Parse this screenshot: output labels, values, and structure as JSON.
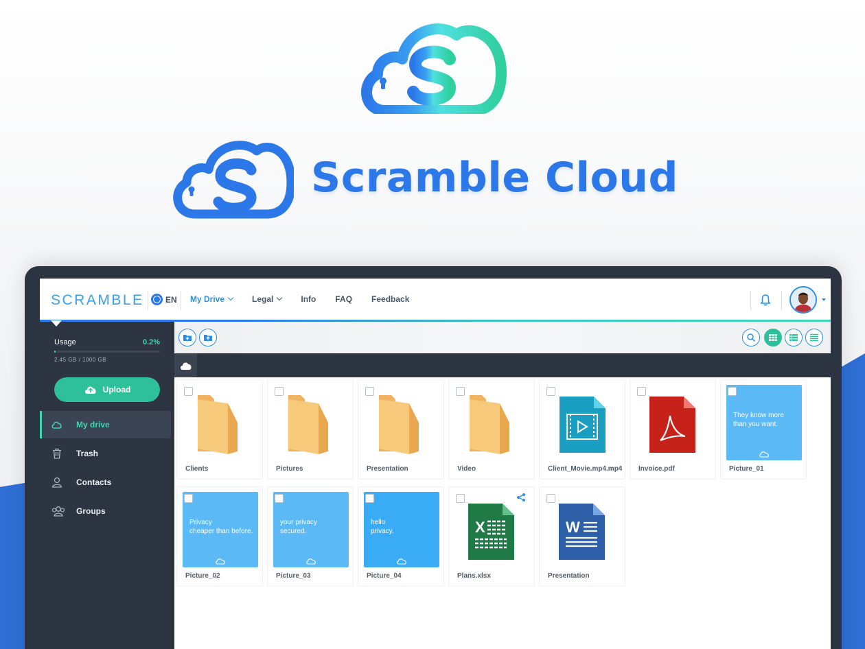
{
  "brand": {
    "name": "Scramble Cloud"
  },
  "app": {
    "logo_text": "SCRAMBLE",
    "language": "EN",
    "nav": [
      {
        "label": "My Drive",
        "has_dropdown": true,
        "active": true
      },
      {
        "label": "Legal",
        "has_dropdown": true,
        "active": false
      },
      {
        "label": "Info",
        "has_dropdown": false,
        "active": false
      },
      {
        "label": "FAQ",
        "has_dropdown": false,
        "active": false
      },
      {
        "label": "Feedback",
        "has_dropdown": false,
        "active": false
      }
    ]
  },
  "sidebar": {
    "usage_label": "Usage",
    "usage_percent": "0.2%",
    "usage_fraction": 0.002,
    "usage_detail": "2.45 GB / 1000 GB",
    "upload_label": "Upload",
    "items": [
      {
        "label": "My drive",
        "icon": "cloud-icon",
        "active": true
      },
      {
        "label": "Trash",
        "icon": "trash-icon",
        "active": false
      },
      {
        "label": "Contacts",
        "icon": "user-icon",
        "active": false
      },
      {
        "label": "Groups",
        "icon": "group-icon",
        "active": false
      }
    ]
  },
  "toolbar": {
    "left_buttons": [
      "new-folder-icon",
      "upload-folder-icon"
    ],
    "right_buttons": [
      "search-icon",
      "grid-view-icon",
      "list-view-icon",
      "compact-list-icon"
    ],
    "active_view": "grid-view-icon"
  },
  "files": [
    {
      "name": "Clients",
      "type": "folder"
    },
    {
      "name": "Pictures",
      "type": "folder"
    },
    {
      "name": "Presentation",
      "type": "folder"
    },
    {
      "name": "Video",
      "type": "folder"
    },
    {
      "name": "Client_Movie.mp4.mp4",
      "type": "video"
    },
    {
      "name": "Invoice.pdf",
      "type": "pdf"
    },
    {
      "name": "Picture_01",
      "type": "image",
      "text": "They know more\nthan you want."
    },
    {
      "name": "Picture_02",
      "type": "image",
      "text": "Privacy\ncheaper than before."
    },
    {
      "name": "Picture_03",
      "type": "image",
      "text": "your privacy\nsecured."
    },
    {
      "name": "Picture_04",
      "type": "image",
      "text": "hello\nprivacy."
    },
    {
      "name": "Plans.xlsx",
      "type": "excel",
      "shared": true
    },
    {
      "name": "Presentation",
      "type": "word"
    }
  ],
  "colors": {
    "brand_blue": "#2c78e8",
    "accent_teal": "#3fd7b5",
    "sidebar_bg": "#2d3542",
    "upload_green": "#2ec09a",
    "picture_blue": "#5bb9f6"
  }
}
